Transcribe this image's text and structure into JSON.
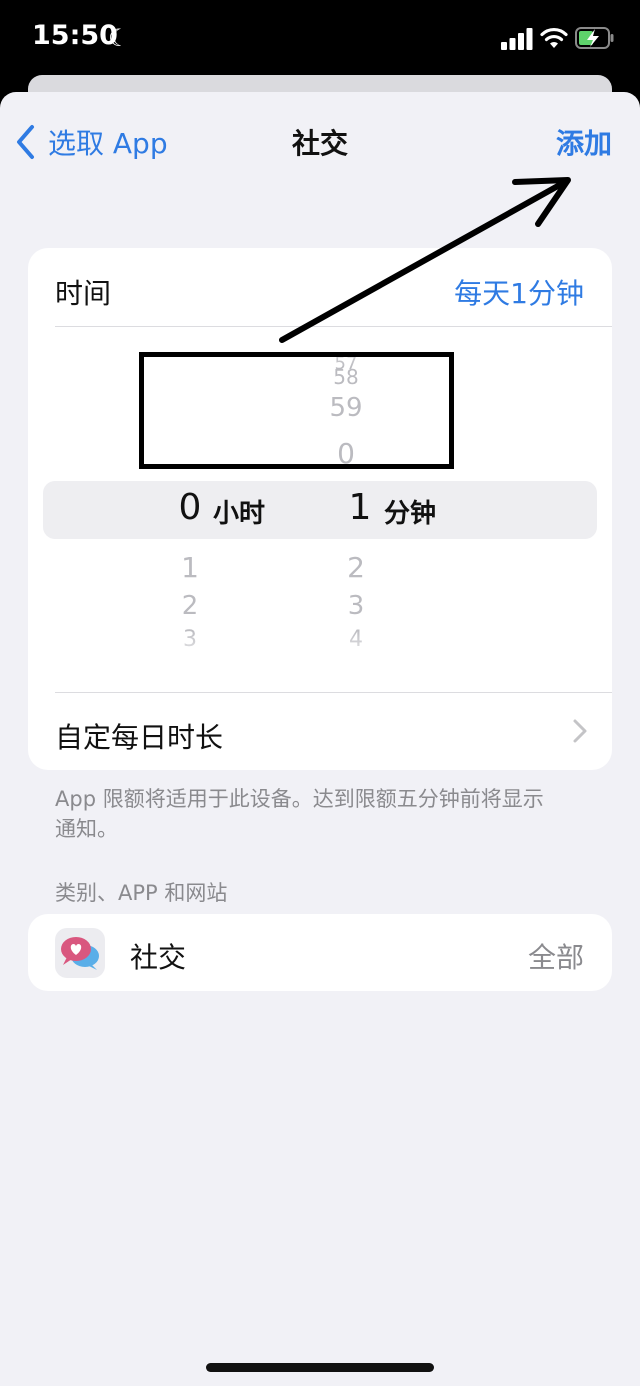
{
  "status": {
    "time": "15:50"
  },
  "nav": {
    "back_label": "选取 App",
    "title": "社交",
    "add_label": "添加"
  },
  "time_row": {
    "label": "时间",
    "value": "每天1分钟"
  },
  "picker": {
    "hours": {
      "above": [],
      "selected": "0",
      "below": [
        "1",
        "2",
        "3"
      ],
      "unit": "小时"
    },
    "minutes": {
      "above": [
        "57",
        "58",
        "59",
        "0"
      ],
      "selected": "1",
      "below": [
        "2",
        "3",
        "4"
      ],
      "unit": "分钟"
    }
  },
  "custom_row": {
    "label": "自定每日时长"
  },
  "footnote": "App 限额将适用于此设备。达到限额五分钟前将显示通知。",
  "section_header": "类别、APP 和网站",
  "category": {
    "name": "社交",
    "value": "全部"
  },
  "colors": {
    "accent": "#2f7be3",
    "background": "#f1f1f6"
  }
}
